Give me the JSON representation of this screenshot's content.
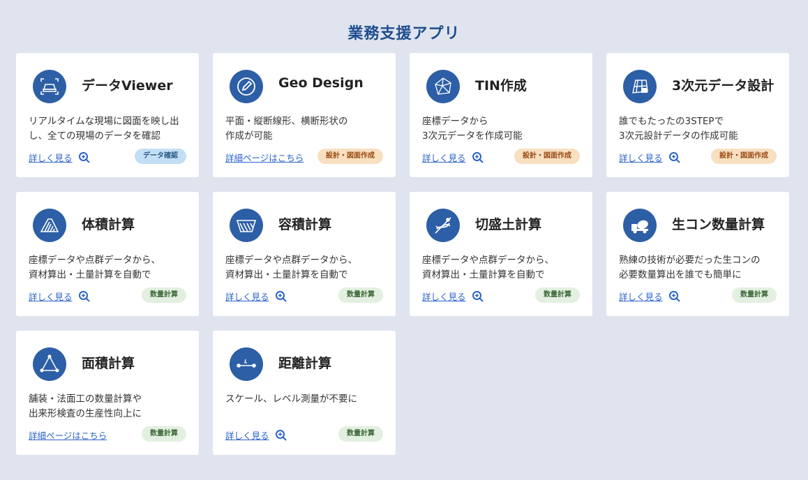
{
  "page": {
    "title": "業務支援アプリ"
  },
  "colors": {
    "icon_bg": "#2d5fa6",
    "link": "#2a62c9",
    "badge_blue": "#c2dff5",
    "badge_orange": "#f8dfc0",
    "badge_green": "#e3efe0"
  },
  "cards": [
    {
      "title": "データViewer",
      "icon": "viewer-icon",
      "desc": [
        "リアルタイムな現場に図面を映し出",
        "し、全ての現場のデータを確認"
      ],
      "link": "詳しく見る",
      "badge": "データ確認"
    },
    {
      "title": "Geo Design",
      "icon": "pencil-icon",
      "desc": [
        "平面・縦断線形、横断形状の",
        "作成が可能"
      ],
      "link": "詳細ページはこちら",
      "badge": "設計・図面作成"
    },
    {
      "title": "TIN作成",
      "icon": "tin-mesh-icon",
      "desc": [
        "座標データから",
        "3次元データを作成可能"
      ],
      "link": "詳しく見る",
      "badge": "設計・図面作成"
    },
    {
      "title": "3次元データ設計",
      "icon": "3d-design-icon",
      "desc": [
        "誰でもたったの3STEPで",
        "3次元設計データの作成可能"
      ],
      "link": "詳しく見る",
      "badge": "設計・図面作成"
    },
    {
      "title": "体積計算",
      "icon": "volume-icon",
      "desc": [
        "座標データや点群データから、",
        "資材算出・土量計算を自動で"
      ],
      "link": "詳しく見る",
      "badge": "数量計算"
    },
    {
      "title": "容積計算",
      "icon": "capacity-icon",
      "desc": [
        "座標データや点群データから、",
        "資材算出・土量計算を自動で"
      ],
      "link": "詳しく見る",
      "badge": "数量計算"
    },
    {
      "title": "切盛土計算",
      "icon": "cut-fill-icon",
      "desc": [
        "座標データや点群データから、",
        "資材算出・土量計算を自動で"
      ],
      "link": "詳しく見る",
      "badge": "数量計算"
    },
    {
      "title": "生コン数量計算",
      "icon": "concrete-mixer-icon",
      "desc": [
        "熟練の技術が必要だった生コンの",
        "必要数量算出を誰でも簡単に"
      ],
      "link": "詳しく見る",
      "badge": "数量計算"
    },
    {
      "title": "面積計算",
      "icon": "area-triangle-icon",
      "desc": [
        "舗装・法面工の数量計算や",
        "出来形検査の生産性向上に"
      ],
      "link": "詳細ページはこちら",
      "badge": "数量計算"
    },
    {
      "title": "距離計算",
      "icon": "distance-icon",
      "desc": [
        "スケール、レベル測量が不要に"
      ],
      "link": "詳しく見る",
      "badge": "数量計算"
    }
  ]
}
